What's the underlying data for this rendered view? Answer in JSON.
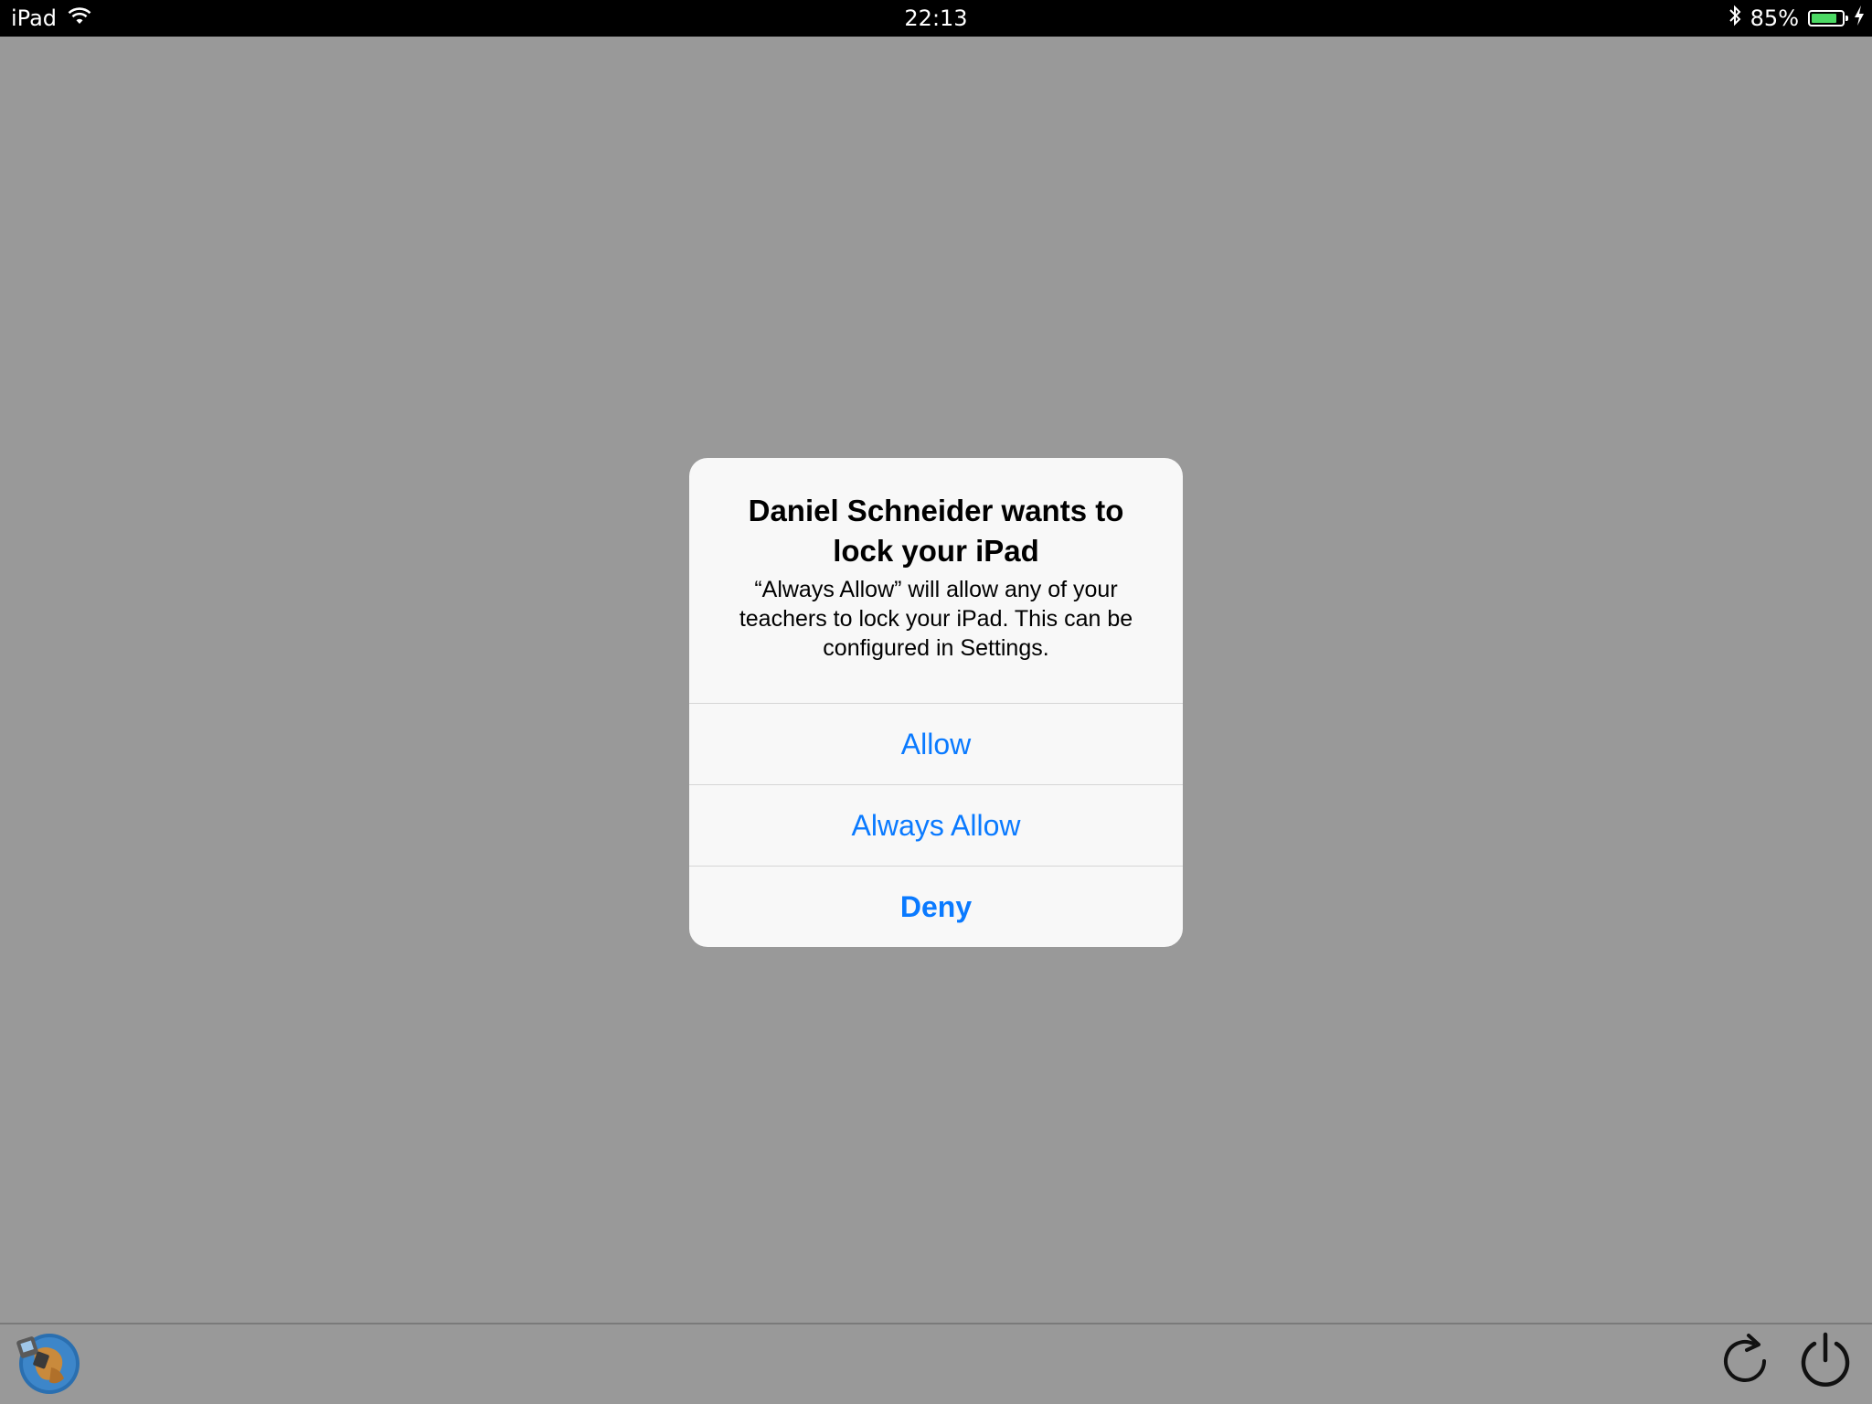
{
  "status_bar": {
    "device": "iPad",
    "time": "22:13",
    "battery_percent_label": "85%",
    "battery_level": 0.85,
    "icons": [
      "wifi-icon",
      "bluetooth-icon",
      "battery-icon",
      "charging-bolt-icon"
    ]
  },
  "dialog": {
    "title": "Daniel Schneider wants to lock your iPad",
    "message": "“Always Allow” will allow any of your teachers to lock your iPad. This can be configured in Settings.",
    "buttons": {
      "allow": "Allow",
      "always_allow": "Always Allow",
      "deny": "Deny"
    }
  },
  "toolbar": {
    "left_icon": "app-logo-icon",
    "right_icons": [
      "refresh-icon",
      "power-icon"
    ]
  },
  "colors": {
    "background": "#999999",
    "status_bar": "#000000",
    "dialog_background": "#f8f8f8",
    "button_text": "#0a7aff",
    "battery_fill": "#4cd964"
  }
}
